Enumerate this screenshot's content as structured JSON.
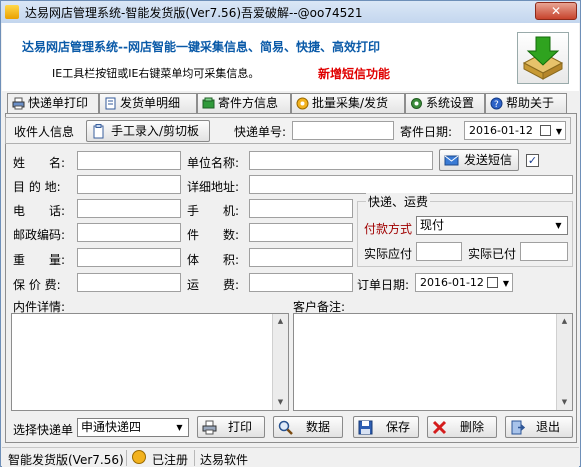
{
  "window": {
    "title": "达易网店管理系统-智能发货版(Ver7.56)吾爱破解--@oo74521",
    "close_label": "✕"
  },
  "header": {
    "slogan": "达易网店管理系统--网店智能一键采集信息、简易、快捷、高效打印",
    "hint": "IE工具栏按钮或IE右键菜单均可采集信息。",
    "promo": "新增短信功能"
  },
  "tabs": [
    {
      "label": "快递单打印",
      "icon": "printer-icon"
    },
    {
      "label": "发货单明细",
      "icon": "document-icon"
    },
    {
      "label": "寄件方信息",
      "icon": "sender-icon"
    },
    {
      "label": "批量采集/发货",
      "icon": "batch-icon"
    },
    {
      "label": "系统设置",
      "icon": "gear-icon"
    },
    {
      "label": "帮助关于",
      "icon": "help-icon"
    }
  ],
  "recipient_bar": {
    "section_label": "收件人信息",
    "manual_button": "手工录入/剪切板",
    "tracking_label": "快递单号:",
    "tracking_value": "",
    "send_date_label": "寄件日期:",
    "send_date_value": "2016-01-12"
  },
  "form": {
    "name_label": "姓　　名:",
    "name_value": "",
    "company_label": "单位名称:",
    "company_value": "",
    "sms_button": "发送短信",
    "sms_checked": true,
    "destination_label": "目 的 地:",
    "destination_value": "",
    "address_label": "详细地址:",
    "address_value": "",
    "phone_label": "电　　话:",
    "phone_value": "",
    "mobile_label": "手　　机:",
    "mobile_value": "",
    "zip_label": "邮政编码:",
    "zip_value": "",
    "pieces_label": "件　　数:",
    "pieces_value": "",
    "weight_label": "重　　量:",
    "weight_value": "",
    "volume_label": "体　　积:",
    "volume_value": "",
    "insured_label": "保 价 费:",
    "insured_value": "",
    "freight_label": "运　　费:",
    "freight_value": ""
  },
  "shipping_group": {
    "title": "快递、运费",
    "payment_label": "付款方式",
    "payment_value": "现付",
    "due_label": "实际应付",
    "due_value": "",
    "paid_label": "实际已付",
    "paid_value": ""
  },
  "order_date": {
    "label": "订单日期:",
    "value": "2016-01-12"
  },
  "notes": {
    "items_label": "内件详情:",
    "items_value": "",
    "remark_label": "客户备注:",
    "remark_value": ""
  },
  "bottom": {
    "courier_label": "选择快递单",
    "courier_value": "申通快递四",
    "print": "打印",
    "data": "数据",
    "save": "保存",
    "delete": "删除",
    "exit": "退出"
  },
  "statusbar": {
    "version": "智能发货版(Ver7.56)",
    "registered": "已注册",
    "vendor": "达易软件"
  },
  "colors": {
    "slogan": "#0a5aa8",
    "promo": "#e00000",
    "payment_label": "#a00000"
  }
}
